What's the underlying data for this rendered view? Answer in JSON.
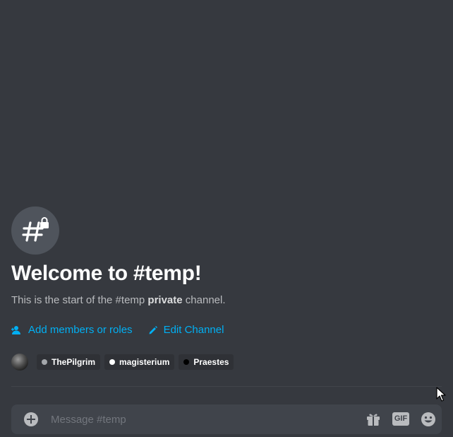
{
  "channel": {
    "name": "temp",
    "icon": "hashtag-lock-icon"
  },
  "welcome": {
    "title": "Welcome to #temp!",
    "desc_prefix": "This is the start of the #temp ",
    "desc_bold": "private",
    "desc_suffix": " channel."
  },
  "actions": {
    "add_members": {
      "label": "Add members or roles",
      "icon": "add-user-icon"
    },
    "edit_channel": {
      "label": "Edit Channel",
      "icon": "pencil-icon"
    }
  },
  "members": [
    {
      "name": "ThePilgrim",
      "dot_color": "#a3a6aa"
    },
    {
      "name": "magisterium",
      "dot_color": "#ffffff"
    },
    {
      "name": "Praestes",
      "dot_color": "#000000"
    }
  ],
  "composer": {
    "placeholder": "Message #temp",
    "icons": [
      "add-circle-icon",
      "gift-icon",
      "gif-icon",
      "emoji-icon"
    ],
    "gif_label": "GIF"
  },
  "colors": {
    "background": "#36393f",
    "link": "#00b0f4",
    "chip": "#2f3136",
    "composer": "#40444b"
  }
}
